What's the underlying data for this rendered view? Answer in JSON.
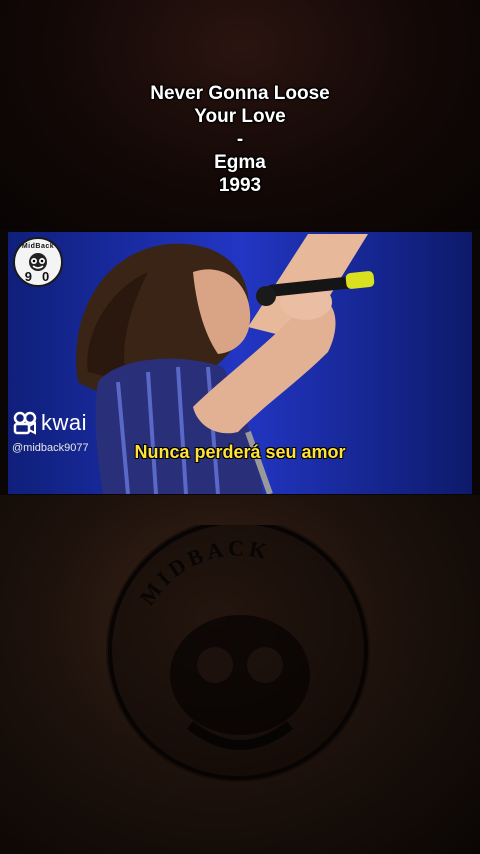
{
  "title_overlay": {
    "line1": "Never Gonna Loose",
    "line2": "Your Love",
    "line3": "-",
    "line4": "Egma",
    "line5": "1993"
  },
  "channel_badge": {
    "text": "MidBack",
    "number": "90"
  },
  "kwai": {
    "brand": "kwai",
    "handle": "@midback9077"
  },
  "video": {
    "subtitle": "Nunca perderá seu amor"
  },
  "watermark": {
    "text": "MIDBACK"
  },
  "colors": {
    "subtitle": "#ffe23a",
    "stage_blue": "#1a2fb0",
    "background": "#0a0606"
  }
}
